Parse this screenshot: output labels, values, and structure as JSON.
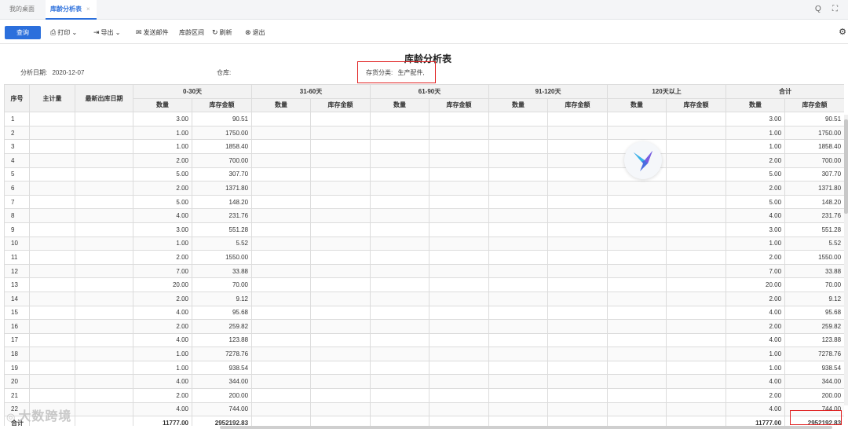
{
  "tabs": {
    "home": "我的桌面",
    "active": "库龄分析表",
    "close": "×"
  },
  "window_icons": {
    "search": "Q",
    "fullscreen": "⛶"
  },
  "toolbar": {
    "query": "查询",
    "print": "打印",
    "export": "导出",
    "send_mail": "发送邮件",
    "age_range": "库龄区间",
    "refresh": "刷新",
    "exit": "退出",
    "icons": [
      "print-icon",
      "export-icon",
      "mail-icon",
      "refresh-icon",
      "exit-icon",
      "gear-icon"
    ]
  },
  "report": {
    "title": "库龄分析表",
    "date_label": "分析日期:",
    "date_value": "2020-12-07",
    "warehouse_label": "仓库:",
    "category_label": "存货分类:",
    "category_value": "生产配件,"
  },
  "headers": {
    "seq": "序号",
    "unit": "主计量",
    "last_out": "最新出库日期",
    "groups": [
      "0-30天",
      "31-60天",
      "61-90天",
      "91-120天",
      "120天以上",
      "合计"
    ],
    "qty": "数量",
    "amount": "库存金额"
  },
  "rows": [
    {
      "seq": "1",
      "qty": "3.00",
      "amt": "90.51"
    },
    {
      "seq": "2",
      "qty": "1.00",
      "amt": "1750.00"
    },
    {
      "seq": "3",
      "qty": "1.00",
      "amt": "1858.40"
    },
    {
      "seq": "4",
      "qty": "2.00",
      "amt": "700.00"
    },
    {
      "seq": "5",
      "qty": "5.00",
      "amt": "307.70"
    },
    {
      "seq": "6",
      "qty": "2.00",
      "amt": "1371.80"
    },
    {
      "seq": "7",
      "qty": "5.00",
      "amt": "148.20"
    },
    {
      "seq": "8",
      "qty": "4.00",
      "amt": "231.76"
    },
    {
      "seq": "9",
      "qty": "3.00",
      "amt": "551.28"
    },
    {
      "seq": "10",
      "qty": "1.00",
      "amt": "5.52"
    },
    {
      "seq": "11",
      "qty": "2.00",
      "amt": "1550.00"
    },
    {
      "seq": "12",
      "qty": "7.00",
      "amt": "33.88"
    },
    {
      "seq": "13",
      "qty": "20.00",
      "amt": "70.00"
    },
    {
      "seq": "14",
      "qty": "2.00",
      "amt": "9.12"
    },
    {
      "seq": "15",
      "qty": "4.00",
      "amt": "95.68"
    },
    {
      "seq": "16",
      "qty": "2.00",
      "amt": "259.82"
    },
    {
      "seq": "17",
      "qty": "4.00",
      "amt": "123.88"
    },
    {
      "seq": "18",
      "qty": "1.00",
      "amt": "7278.76"
    },
    {
      "seq": "19",
      "qty": "1.00",
      "amt": "938.54"
    },
    {
      "seq": "20",
      "qty": "4.00",
      "amt": "344.00"
    },
    {
      "seq": "21",
      "qty": "2.00",
      "amt": "200.00"
    },
    {
      "seq": "22",
      "qty": "4.00",
      "amt": "744.00"
    }
  ],
  "total": {
    "label": "合计",
    "qty": "11777.00",
    "amt": "2952192.83"
  },
  "watermark": "大数跨境",
  "colors": {
    "accent": "#2b6fdc",
    "highlight": "#e02020"
  }
}
